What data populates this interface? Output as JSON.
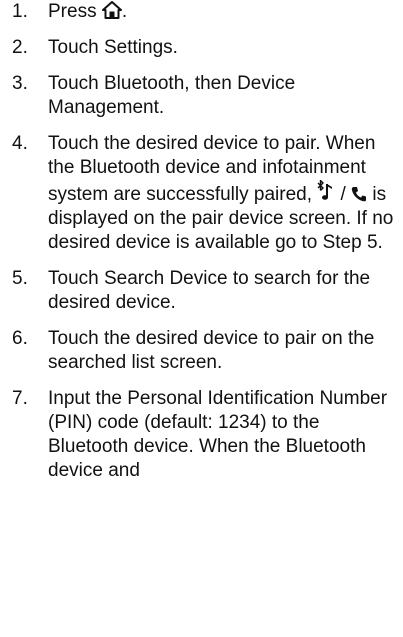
{
  "steps": [
    {
      "num": "1.",
      "before": "Press ",
      "icon": "home-icon",
      "after": "."
    },
    {
      "num": "2.",
      "text": "Touch Settings."
    },
    {
      "num": "3.",
      "text": "Touch Bluetooth, then Device Management."
    },
    {
      "num": "4.",
      "before": "Touch the desired device to pair. When the Bluetooth device and infotainment system are successfully paired, ",
      "icon1": "bluetooth-music-icon",
      "separator": " / ",
      "icon2": "phone-icon",
      "after": " is displayed on the pair device screen. If no desired device is available go to Step 5."
    },
    {
      "num": "5.",
      "text": "Touch Search Device to search for the desired device."
    },
    {
      "num": "6.",
      "text": "Touch the desired device to pair on the searched list screen."
    },
    {
      "num": "7.",
      "text": "Input the Personal Identification Number (PIN) code (default: 1234) to the Bluetooth device. When the Bluetooth device and"
    }
  ]
}
